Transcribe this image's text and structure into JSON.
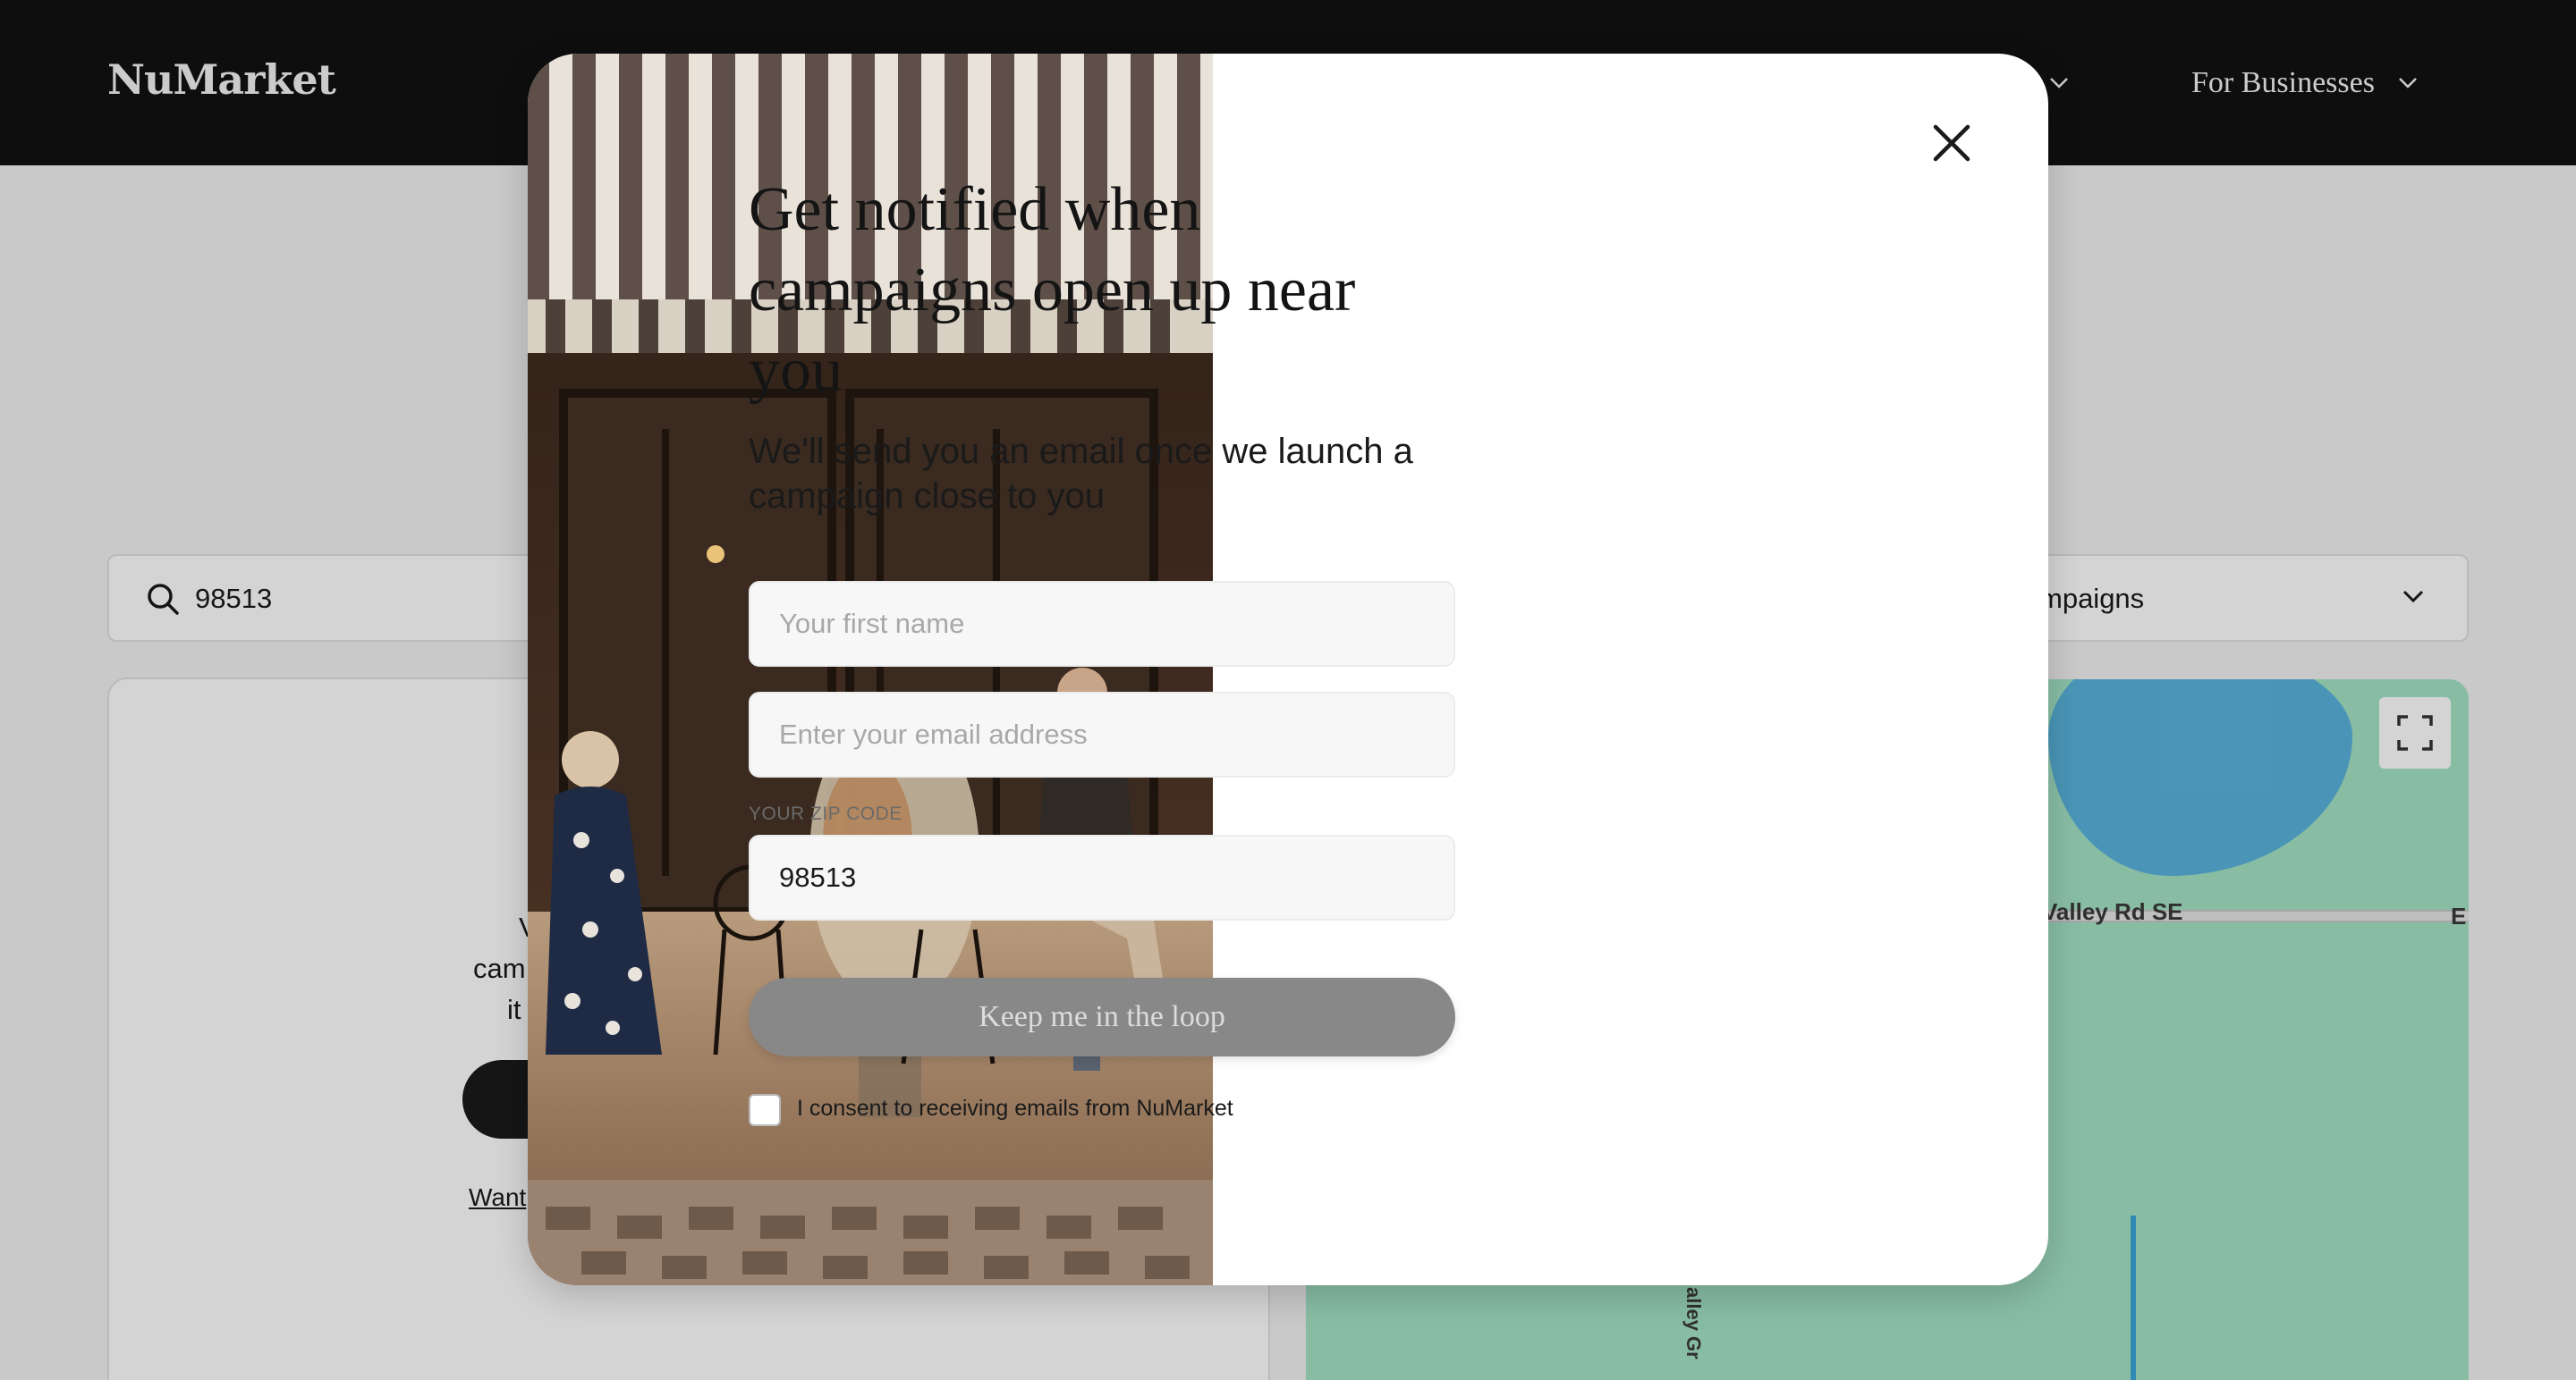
{
  "header": {
    "logo": "NuMarket",
    "nav": [
      {
        "label": "rs",
        "icon": "chevron-down-icon"
      },
      {
        "label": "For Businesses",
        "icon": "chevron-down-icon"
      }
    ]
  },
  "search": {
    "value": "98513",
    "icon": "search-icon"
  },
  "filter": {
    "value": "mpaigns",
    "icon": "chevron-down-icon"
  },
  "results_panel": {
    "lines": [
      "V",
      "cam",
      "it"
    ],
    "link": "Want"
  },
  "map": {
    "road_labels": [
      "Valley Rd SE",
      "E",
      "alley Gr"
    ],
    "expand_icon": "fullscreen-icon",
    "colors": {
      "land": "#a4e4c6",
      "water": "#5ab4dc"
    }
  },
  "modal": {
    "close_icon": "close-icon",
    "title": "Get notified when campaigns open up near you",
    "subtitle": "We'll send you an email once we launch a campaign close to you",
    "first_name_placeholder": "Your first name",
    "email_placeholder": "Enter your email address",
    "zip_label": "YOUR ZIP CODE",
    "zip_value": "98513",
    "submit_label": "Keep me in the loop",
    "consent_label": "I consent to receiving emails from NuMarket",
    "consent_checked": false,
    "photo_alt": "street-cafe-photo"
  }
}
